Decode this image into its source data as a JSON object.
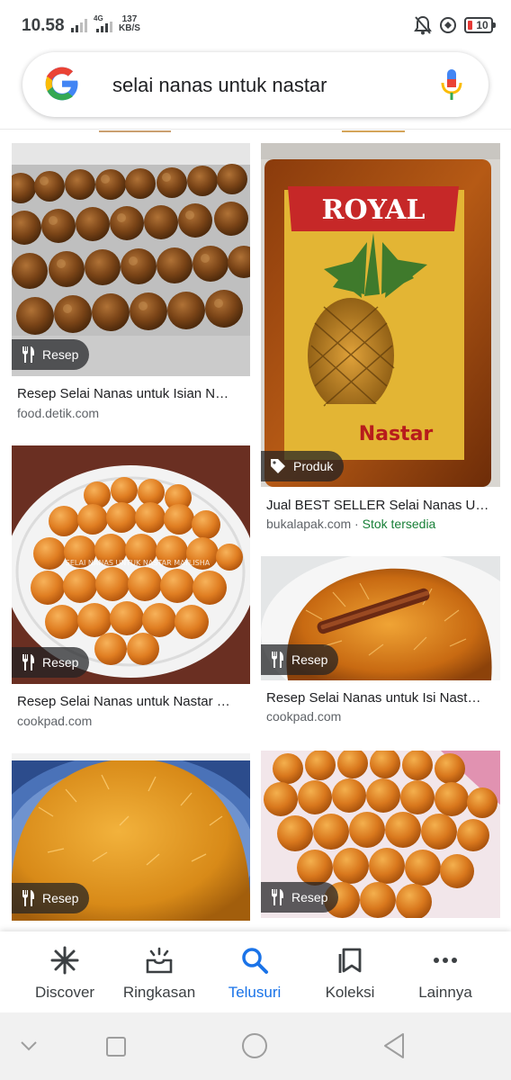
{
  "status_bar": {
    "time": "10.58",
    "network_type": "4G",
    "speed_value": "137",
    "speed_unit": "KB/S",
    "battery": "10",
    "icons": [
      "signal-icon",
      "signal-4g-icon",
      "mute-icon",
      "data-saver-icon",
      "battery-icon"
    ]
  },
  "search": {
    "query": "selai nanas untuk nastar"
  },
  "results": [
    {
      "caption": "Resep Selai Nanas untuk Isian N…",
      "source": "food.detik.com",
      "badge": "Resep",
      "badge_icon": "fork-knife-icon"
    },
    {
      "caption": "Jual BEST SELLER Selai Nanas U…",
      "source": "bukalapak.com",
      "stock": "Stok tersedia",
      "badge": "Produk",
      "badge_icon": "tag-icon",
      "package_text": "ROYAL",
      "package_sub": "Nastar"
    },
    {
      "caption": "Resep Selai Nanas untuk Nastar …",
      "source": "cookpad.com",
      "badge": "Resep",
      "badge_icon": "fork-knife-icon",
      "watermark": "SELAI NANAS UNTUK NASTAR MAYLISHA"
    },
    {
      "caption": "Resep Selai Nanas untuk Isi Nast…",
      "source": "cookpad.com",
      "badge": "Resep",
      "badge_icon": "fork-knife-icon"
    },
    {
      "caption": "",
      "source": "",
      "badge": "Resep",
      "badge_icon": "fork-knife-icon"
    },
    {
      "caption": "",
      "source": "",
      "badge": "Resep",
      "badge_icon": "fork-knife-icon"
    }
  ],
  "bottom_nav": [
    {
      "label": "Discover",
      "icon": "asterisk-icon",
      "active": false
    },
    {
      "label": "Ringkasan",
      "icon": "updates-icon",
      "active": false
    },
    {
      "label": "Telusuri",
      "icon": "search-icon",
      "active": true
    },
    {
      "label": "Koleksi",
      "icon": "collections-icon",
      "active": false
    },
    {
      "label": "Lainnya",
      "icon": "more-icon",
      "active": false
    }
  ],
  "colors": {
    "active": "#1a73e8",
    "stock": "#188038",
    "google_blue": "#4285f4",
    "google_red": "#ea4335",
    "google_yellow": "#fbbc05",
    "google_green": "#34a853"
  }
}
